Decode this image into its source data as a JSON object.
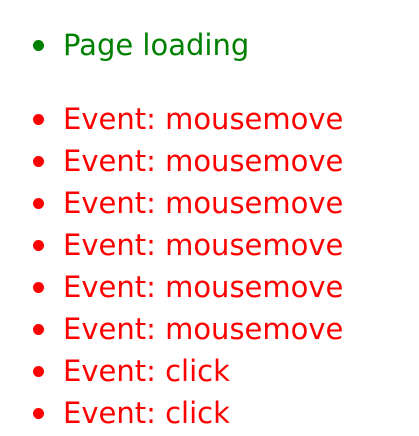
{
  "status": {
    "text": "Page loading",
    "color": "#008000"
  },
  "events": {
    "color": "#ff0000",
    "items": [
      "Event: mousemove",
      "Event: mousemove",
      "Event: mousemove",
      "Event: mousemove",
      "Event: mousemove",
      "Event: mousemove",
      "Event: click",
      "Event: click"
    ]
  }
}
